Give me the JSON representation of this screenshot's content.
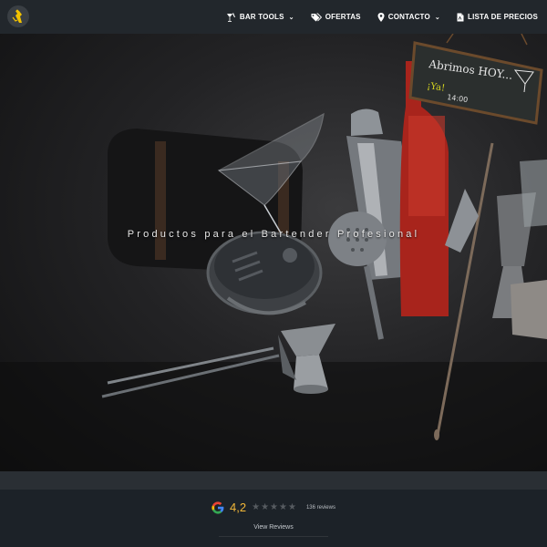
{
  "nav": {
    "items": [
      {
        "label": "BAR TOOLS",
        "icon": "bar-tools-icon",
        "has_dropdown": true
      },
      {
        "label": "OFERTAS",
        "icon": "tags-icon",
        "has_dropdown": false
      },
      {
        "label": "CONTACTO",
        "icon": "map-marker-icon",
        "has_dropdown": true
      },
      {
        "label": "LISTA DE PRECIOS",
        "icon": "pdf-file-icon",
        "has_dropdown": false
      }
    ]
  },
  "hero": {
    "tagline": "Productos para el Bartender Profesional",
    "chalkboard": {
      "line1": "Abrimos HOY...",
      "line2": "¡Ya!",
      "time": "14:00"
    }
  },
  "reviews": {
    "rating": "4,2",
    "stars_filled": 4.2,
    "stars_total": 5,
    "count_text": "136 reviews",
    "link_label": "View Reviews"
  },
  "colors": {
    "topbar": "#22272c",
    "accent_star": "#f3b838",
    "logo_gold": "#f2c200"
  }
}
